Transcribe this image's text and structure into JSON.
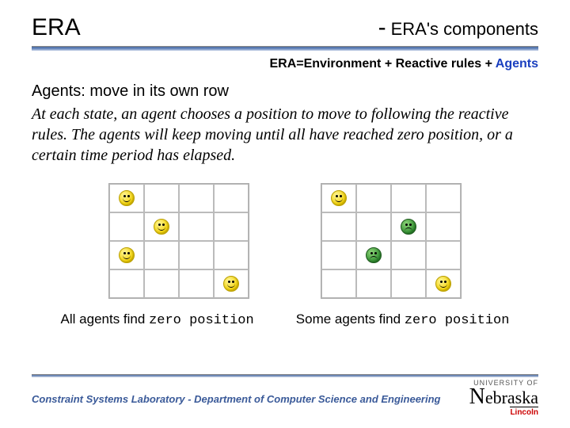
{
  "header": {
    "left": "ERA",
    "dash": "-",
    "right": "ERA's components"
  },
  "subline": {
    "prefix": "ERA=Environment + Reactive rules + ",
    "agents": "Agents"
  },
  "content": {
    "agents_label": "Agents:",
    "agents_desc": " move in its own row",
    "body": "At each state, an agent chooses a position to move to following the reactive rules. The agents will keep moving until all have reached zero position, or a certain time period has elapsed."
  },
  "captions": {
    "left_a": "All agents find ",
    "left_b": "zero position",
    "right_a": "Some agents find ",
    "right_b": "zero position"
  },
  "grids": {
    "left": [
      [
        "y",
        "",
        "",
        ""
      ],
      [
        "",
        "y",
        "",
        ""
      ],
      [
        "y",
        "",
        "",
        ""
      ],
      [
        "",
        "",
        "",
        "y"
      ]
    ],
    "right": [
      [
        "y",
        "",
        "",
        ""
      ],
      [
        "",
        "",
        "g",
        ""
      ],
      [
        "",
        "g",
        "",
        ""
      ],
      [
        "",
        "",
        "",
        "y"
      ]
    ]
  },
  "footer": {
    "text": "Constraint Systems Laboratory - Department of Computer Science and Engineering",
    "logo_top": "UNIVERSITY OF",
    "logo_main": "Nebraska",
    "logo_sub": "Lincoln"
  }
}
